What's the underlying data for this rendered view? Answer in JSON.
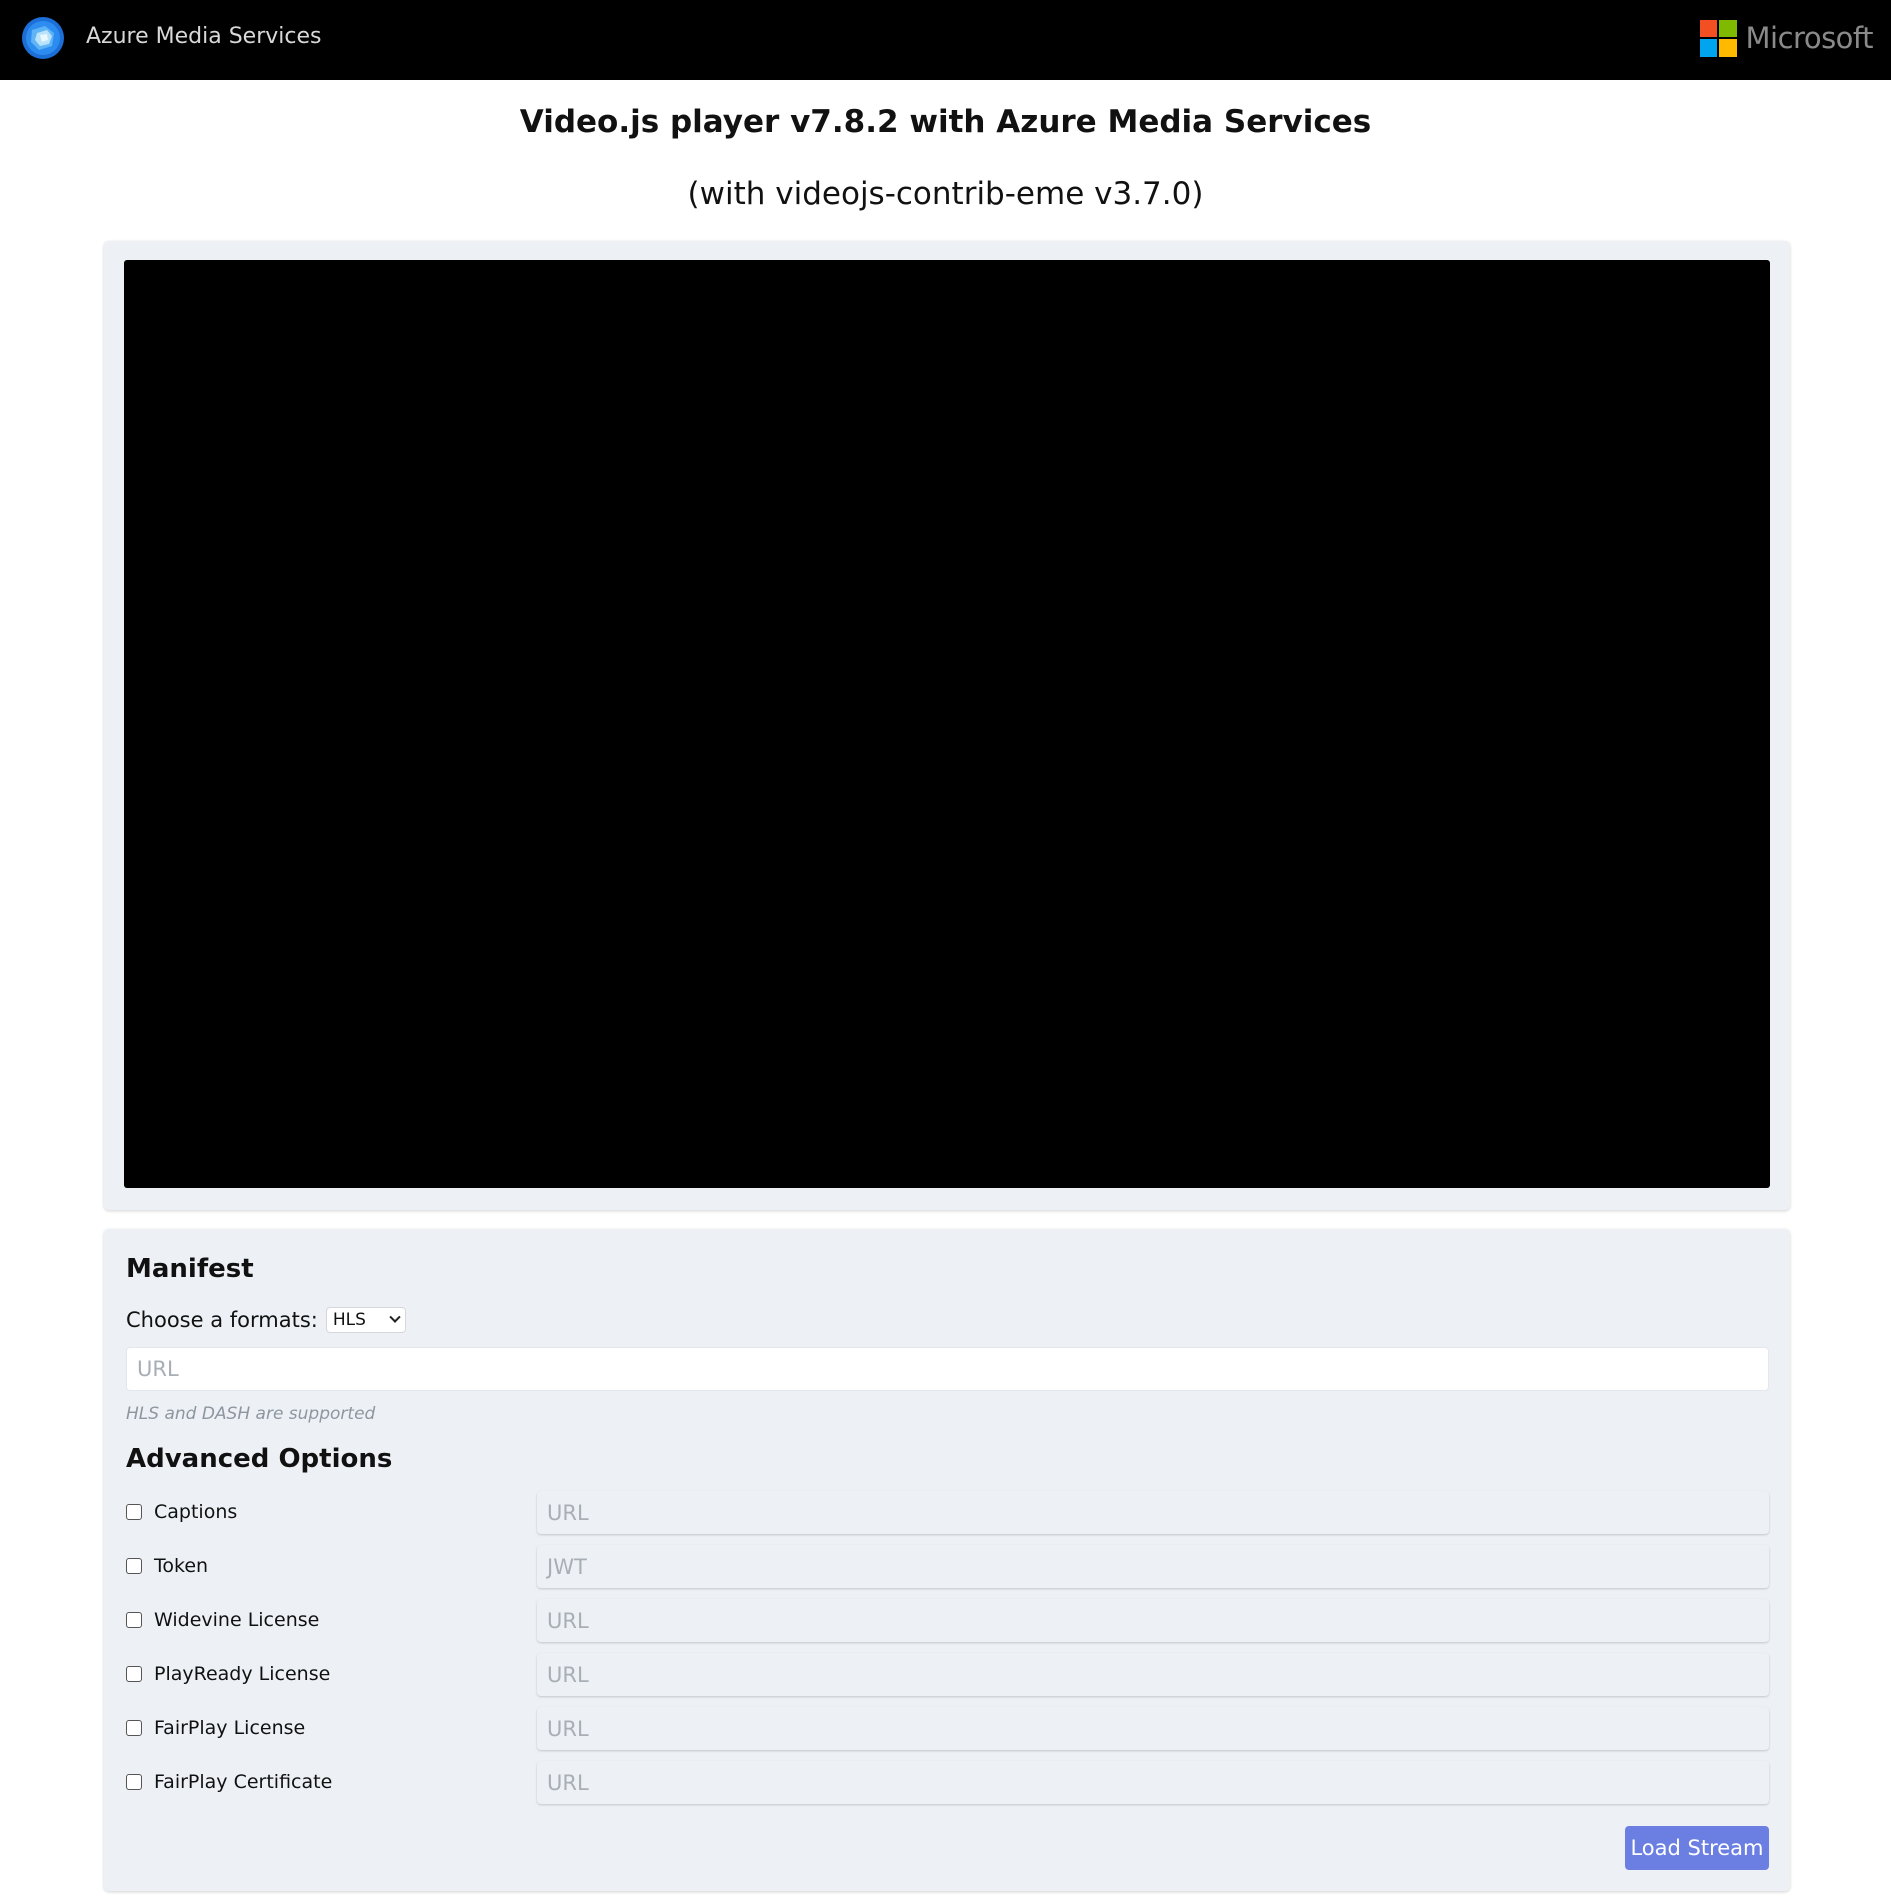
{
  "header": {
    "brand": "Azure Media Services",
    "microsoft": "Microsoft"
  },
  "page": {
    "title": "Video.js player v7.8.2 with Azure Media Services",
    "subtitle": "(with videojs-contrib-eme v3.7.0)"
  },
  "manifest": {
    "heading": "Manifest",
    "format_label": "Choose a formats:",
    "format_selected": "HLS",
    "url_placeholder": "URL",
    "help": "HLS and DASH are supported"
  },
  "advanced": {
    "heading": "Advanced Options",
    "options": [
      {
        "label": "Captions",
        "placeholder": "URL",
        "checked": false
      },
      {
        "label": "Token",
        "placeholder": "JWT",
        "checked": false
      },
      {
        "label": "Widevine License",
        "placeholder": "URL",
        "checked": false
      },
      {
        "label": "PlayReady License",
        "placeholder": "URL",
        "checked": false
      },
      {
        "label": "FairPlay License",
        "placeholder": "URL",
        "checked": false
      },
      {
        "label": "FairPlay Certificate",
        "placeholder": "URL",
        "checked": false
      }
    ]
  },
  "actions": {
    "load_label": "Load Stream"
  },
  "colors": {
    "topbar": "#000000",
    "panel": "#edf1f5",
    "button": "#6b7fe3"
  }
}
